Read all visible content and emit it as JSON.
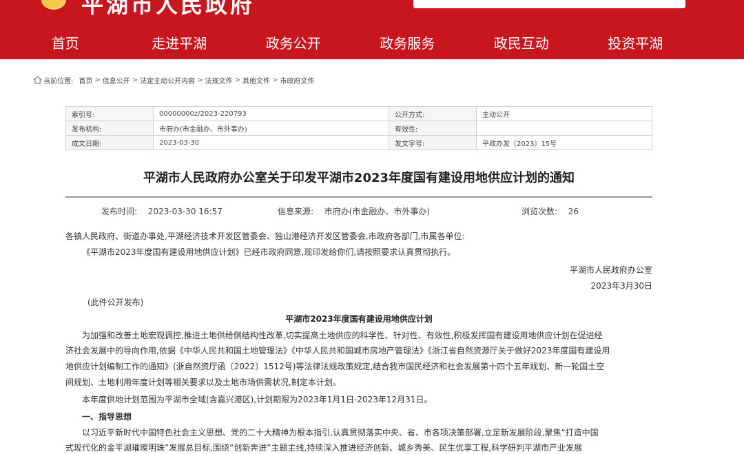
{
  "header": {
    "site_name": "平湖市人民政府",
    "brand_color": "#c8161e"
  },
  "nav": {
    "items": [
      {
        "label": "首页"
      },
      {
        "label": "走进平湖"
      },
      {
        "label": "政务公开"
      },
      {
        "label": "政务服务"
      },
      {
        "label": "政民互动"
      },
      {
        "label": "投资平湖"
      }
    ]
  },
  "breadcrumb": {
    "prefix": "当前位置:",
    "items": [
      "首页",
      "信息公开",
      "法定主动公开内容",
      "法规文件",
      "其他文件",
      "市政府文件"
    ],
    "separator": ">"
  },
  "meta_table": {
    "rows": [
      {
        "k1": "索引号:",
        "v1": "00000000z/2023-220793",
        "k2": "公开方式:",
        "v2": "主动公开"
      },
      {
        "k1": "发布机构:",
        "v1": "市府办(市金融办、市外事办)",
        "k2": "有效性:",
        "v2": ""
      },
      {
        "k1": "成文日期:",
        "v1": "2023-03-30",
        "k2": "发文字号:",
        "v2": "平政办发〔2023〕15号"
      }
    ]
  },
  "document": {
    "title": "平湖市人民政府办公室关于印发平湖市2023年度国有建设用地供应计划的通知",
    "publish_time_label": "发布时间:",
    "publish_time": "2023-03-30 16:57",
    "source_label": "信息来源:",
    "source": "市府办(市金融办、市外事办)",
    "views_label": "浏览次数:",
    "views": "26",
    "addressee": "各镇人民政府、街道办事处,平湖经济技术开发区管委会、独山港经济开发区管委会,市政府各部门,市属各单位:",
    "notice_body": "《平湖市2023年度国有建设用地供应计划》已经市政府同意,现印发给你们,请按照要求认真贯彻执行。",
    "signature": "平湖市人民政府办公室",
    "sign_date": "2023年3月30日",
    "public_note": "(此件公开发布)",
    "plan_title": "平湖市2023年度国有建设用地供应计划",
    "para1_lines": [
      "为加强和改善土地宏观调控,推进土地供给侧结构性改革,切实提高土地供应的科学性、针对性、有效性,积极发挥国有建设用地供应计划在促进经",
      "济社会发展中的导向作用,依据《中华人民共和国土地管理法》《中华人民共和国城市房地产管理法》《浙江省自然资源厅关于做好2023年度国有建设用",
      "地供应计划编制工作的通知》(浙自然资厅函〔2022〕1512号)等法律法规政策规定,结合我市国民经济和社会发展第十四个五年规划、新一轮国土空",
      "间规划、土地利用年度计划等相关要求以及土地市场供需状况,制定本计划。"
    ],
    "para2": "本年度供地计划范围为平湖市全域(含嘉兴港区),计划期限为2023年1月1日-2023年12月31日。",
    "section1_title": "一、指导思想",
    "section1_lines": [
      "以习近平新时代中国特色社会主义思想、党的二十大精神为根本指引,认真贯彻落实中央、省、市各项决策部署,立足新发展阶段,聚焦“打造中国",
      "式现代化的金平湖璀璨明珠”发展总目标,围绕“创新奔进”主题主线,持续深入推进经济创新、城乡秀美、民生优享工程,科学研判平湖市产业发展"
    ]
  }
}
